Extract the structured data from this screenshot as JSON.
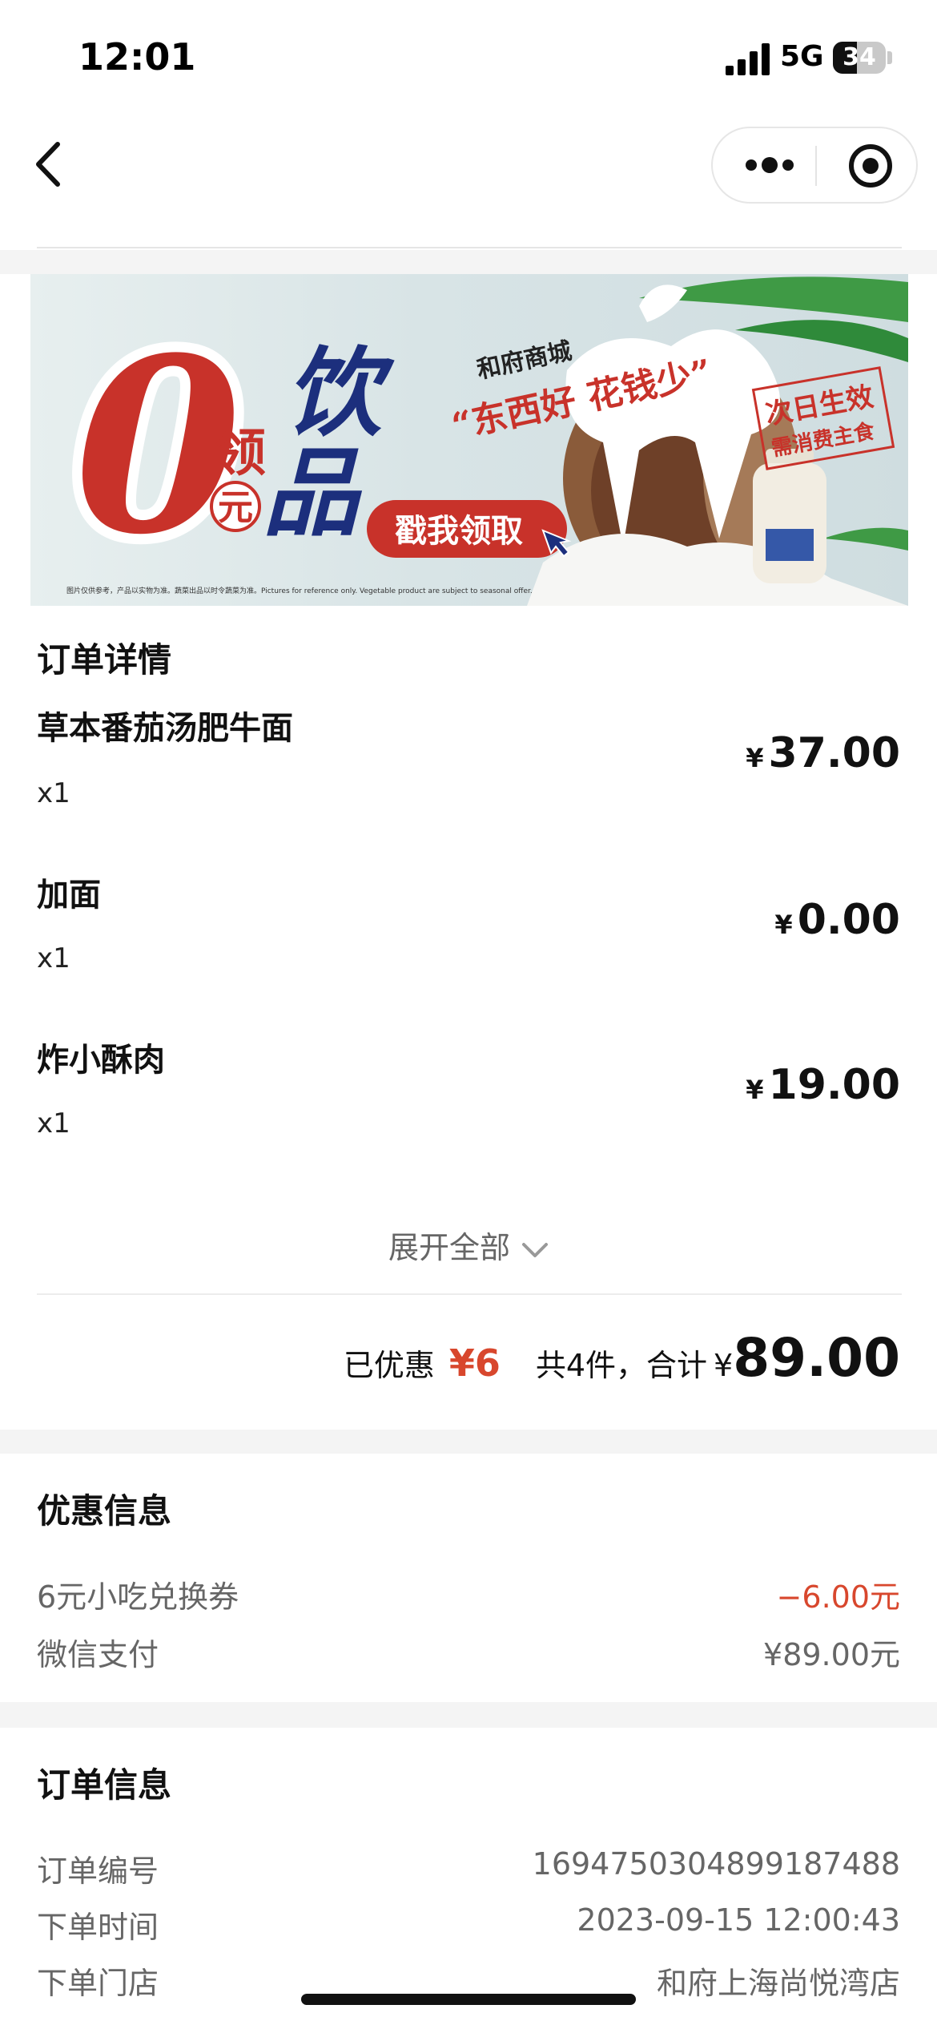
{
  "status_bar": {
    "time": "12:01",
    "network": "5G",
    "battery": "34"
  },
  "banner": {
    "big_zero": "0",
    "ling": "领",
    "yuan": "元",
    "yin": "饮",
    "pin": "品",
    "mall": "和府商城",
    "slogan": "“东西好 花钱少”",
    "button": "戳我领取",
    "stamp_line1": "次日生效",
    "stamp_line2": "需消费主食",
    "disclaimer": "图片仅供参考，产品以实物为准。蔬菜出品以时令蔬菜为准。Pictures for reference only. Vegetable product are subject to seasonal offer."
  },
  "order_details": {
    "title": "订单详情",
    "items": [
      {
        "name": "草本番茄汤肥牛面",
        "qty": "x1",
        "currency": "¥",
        "price": "37.00"
      },
      {
        "name": "加面",
        "qty": "x1",
        "currency": "¥",
        "price": "0.00"
      },
      {
        "name": "炸小酥肉",
        "qty": "x1",
        "currency": "¥",
        "price": "19.00"
      }
    ],
    "expand_label": "展开全部",
    "summary": {
      "discount_label": "已优惠",
      "discount_value": "¥6",
      "count_label": "共4件，合计",
      "currency": "¥",
      "total": "89.00"
    }
  },
  "discount_info": {
    "title": "优惠信息",
    "rows": [
      {
        "label": "6元小吃兑换券",
        "value": "−6.00元"
      },
      {
        "label": "微信支付",
        "value": "¥89.00元"
      }
    ]
  },
  "order_info": {
    "title": "订单信息",
    "rows": [
      {
        "label": "订单编号",
        "value": "1694750304899187488"
      },
      {
        "label": "下单时间",
        "value": "2023-09-15 12:00:43"
      },
      {
        "label": "下单门店",
        "value": "和府上海尚悦湾店"
      }
    ]
  },
  "colors": {
    "accent_red": "#d8472d",
    "banner_red": "#c8322a",
    "banner_navy": "#1c2f7d"
  },
  "icons": [
    "back-icon",
    "more-icon",
    "target-icon",
    "chevron-down-icon",
    "signal-icon",
    "battery-icon"
  ]
}
